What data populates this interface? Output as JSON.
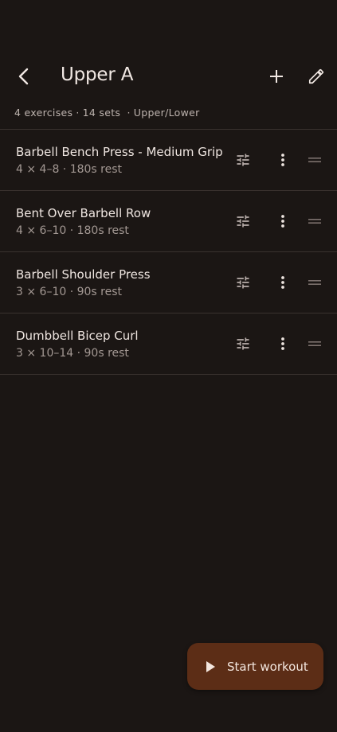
{
  "header": {
    "title": "Upper A",
    "back_icon": "chevron-left-icon",
    "add_icon": "plus-icon",
    "edit_icon": "pencil-icon"
  },
  "meta": {
    "exercises": "4 exercises",
    "sets": "14 sets",
    "split": "Upper/Lower"
  },
  "exercises": [
    {
      "name": "Barbell Bench Press - Medium Grip",
      "detail": "4 × 4–8 · 180s rest"
    },
    {
      "name": "Bent Over Barbell Row",
      "detail": "4 × 6–10 · 180s rest"
    },
    {
      "name": "Barbell Shoulder Press",
      "detail": "3 × 6–10 · 90s rest"
    },
    {
      "name": "Dumbbell Bicep Curl",
      "detail": "3 × 10–14 · 90s rest"
    }
  ],
  "fab": {
    "label": "Start workout",
    "icon": "play-icon"
  },
  "colors": {
    "background": "#1b1614",
    "fab_background": "#5c2d16",
    "divider": "#3a322f"
  }
}
